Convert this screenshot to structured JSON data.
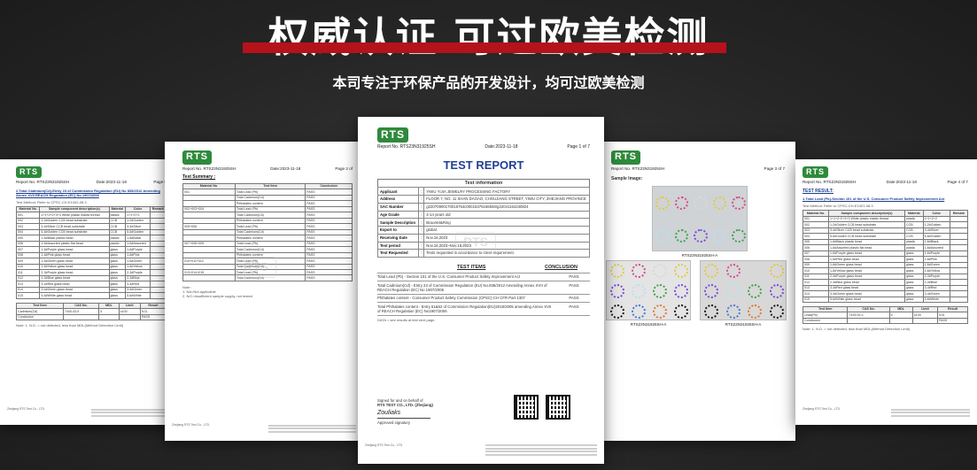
{
  "banner": {
    "headline": "权威认证 可过欧美检测",
    "subhead": "本司专注于环保产品的开发设计，均可过欧美检测",
    "accent_color": "#b5121b"
  },
  "brand": {
    "logo": "RTS",
    "logo_color": "#2f8a3c"
  },
  "doc_center": {
    "report_no": "Report No. RTS23N31925SH",
    "date": "Date:2023-11-18",
    "page": "Page 1 of 7",
    "title": "TEST REPORT",
    "info_heading": "Test information",
    "info": [
      {
        "k": "Applicant",
        "v": "YIWU YIJIA JEWELRY PROCESSING FACTORY"
      },
      {
        "k": "Address",
        "v": "FLOOR 7, NO. 11 SHAN DAOAO, CHOUJIANG STREET, YIWU CITY, ZHEJIANG PROVINCE"
      },
      {
        "k": "SAC Number",
        "v": "g22070900170018754c00015375166550/g22041154230824"
      },
      {
        "k": "Age Grade",
        "v": "4-14 years old"
      },
      {
        "k": "Sample Description",
        "v": "Bracelet&Ring"
      },
      {
        "k": "Export to",
        "v": "global"
      },
      {
        "k": "Receiving Date",
        "v": "Nov.16,2023"
      },
      {
        "k": "Test period",
        "v": "Nov.16,2023~Nov.18,2023"
      },
      {
        "k": "Test Requested",
        "v": "Tests requested in accordance to client requirement."
      }
    ],
    "items_label": "TEST ITEMS",
    "conclusion_label": "CONCLUSION",
    "items": [
      {
        "t": "Total Lead (Pb) - Section 101 of the U.S. Consumer Product Safety Improvement Act",
        "c": "PASS"
      },
      {
        "t": "Total Cadmium(Cd) - Entry 23 of Commission Regulation (EU) No.835/2012 Amending Annex XVII of REACH Regulation (EC) No 1907/2006",
        "c": "PASS"
      },
      {
        "t": "Phthalates content - Consumer Product Safety Commission (CPSC)-CH CFR Part 1307",
        "c": "PASS"
      },
      {
        "t": "Total Phthalates content - Entry 51&52 of Commission Regulation(EU)2018/2005 amending Annex XVII of REACH Regulation (EC) No1907/2006",
        "c": "PASS"
      }
    ],
    "data_note": "DATA = see results at test next page.",
    "signed_for": "Signed for and on behalf of",
    "signed_company": "RTS TEST CO., LTD. (Zhejiang)",
    "approved": "Approved signatory",
    "signature": "Zouliaks",
    "footer_company": "Zhejiang RTS Test Co., LTD."
  },
  "doc_left2": {
    "report_no": "Report No. RTS23N31925SH",
    "date": "Date:2023-11-18",
    "page": "Page 2 of",
    "summary_label": "Test Summary :",
    "headers": [
      "Material No.",
      "Test Item",
      "Conclusion"
    ],
    "rows": [
      {
        "m": "001",
        "t": "Total Lead (Pb)",
        "c": "PASS"
      },
      {
        "m": "",
        "t": "Total Cadmium(Cd)",
        "c": "PASS"
      },
      {
        "m": "",
        "t": "Phthalates content",
        "c": "PASS"
      },
      {
        "m": "002+003+004",
        "t": "Total Lead (Pb)",
        "c": "PASS"
      },
      {
        "m": "",
        "t": "Total Cadmium(Cd)",
        "c": "PASS"
      },
      {
        "m": "",
        "t": "Phthalates content",
        "c": "PASS"
      },
      {
        "m": "005+006",
        "t": "Total Lead (Pb)",
        "c": "PASS"
      },
      {
        "m": "",
        "t": "Total Cadmium(Cd)",
        "c": "PASS"
      },
      {
        "m": "",
        "t": "Phthalates content",
        "c": "PASS"
      },
      {
        "m": "007+008+009",
        "t": "Total Lead (Pb)",
        "c": "PASS"
      },
      {
        "m": "",
        "t": "Total Cadmium(Cd)",
        "c": "PASS"
      },
      {
        "m": "",
        "t": "Phthalates content",
        "c": "PASS"
      },
      {
        "m": "010+011+012",
        "t": "Total Lead (Pb)",
        "c": "PASS"
      },
      {
        "m": "",
        "t": "Total Cadmium(Cd)",
        "c": "PASS"
      },
      {
        "m": "013+014+015",
        "t": "Total Lead (Pb)",
        "c": "PASS"
      },
      {
        "m": "",
        "t": "Total Cadmium(Cd)",
        "c": "PASS"
      }
    ],
    "notes": [
      "Note :",
      "1. NA=Not applicable",
      "2. N/C=Insufficient sample supply, not tested"
    ],
    "footer_company": "Zhejiang RTS Test Co., LTD."
  },
  "doc_left1": {
    "report_no": "Report No. RTS23N31925SH",
    "date": "Date:2023-11-18",
    "page": "Page 5",
    "heading": "2.Total Cadmium(Cd)-Entry 23 of Commission Regulation (EU) No 835/2012 Amending Annex XVII REACH Regulation (EC) No 1907/2006",
    "method": "Test Method: Refer to CPSC-CH-E1002-08.3",
    "headers": [
      "Material No.",
      "Sample component description(s)",
      "Material",
      "Color",
      "Remark"
    ],
    "rows": [
      {
        "n": "001",
        "d": "1+1+2+2+3+3 White plastic elastic thread",
        "m": "plastic",
        "c": "1+1+2+2"
      },
      {
        "n": "002",
        "d": "1-2#Golden CCB bead substrate",
        "m": "CCB",
        "c": "1-2#Golden"
      },
      {
        "n": "003",
        "d": "3-4#Silver CCB bead substrate",
        "m": "CCB",
        "c": "3-4#Silver"
      },
      {
        "n": "004",
        "d": "5-6#Golden CCB bead substrate",
        "m": "CCB",
        "c": "5-6#Golden"
      },
      {
        "n": "005",
        "d": "1-6#Black plastic bead",
        "m": "plastic",
        "c": "1-6#Black"
      },
      {
        "n": "006",
        "d": "1-6#Assorted plastic flat bead",
        "m": "plastic",
        "c": "1-6#Assorted"
      },
      {
        "n": "007",
        "d": "1-6#Purple glass bead",
        "m": "glass",
        "c": "1-6#Purple"
      },
      {
        "n": "008",
        "d": "1-6#Pink glass bead",
        "m": "glass",
        "c": "1-6#Pink"
      },
      {
        "n": "009",
        "d": "1-6#Green glass bead",
        "m": "glass",
        "c": "1-6#Green"
      },
      {
        "n": "010",
        "d": "1-6#Yellow glass bead",
        "m": "glass",
        "c": "1-6#Yellow"
      },
      {
        "n": "011",
        "d": "2-3#Purple glass bead",
        "m": "glass",
        "c": "2-3#Purple"
      },
      {
        "n": "012",
        "d": "2-3#Blue glass bead",
        "m": "glass",
        "c": "2-3#Blue"
      },
      {
        "n": "013",
        "d": "3-4#Red glass bead",
        "m": "glass",
        "c": "3-4#Red"
      },
      {
        "n": "014",
        "d": "3-4#Green glass bead",
        "m": "glass",
        "c": "3-4#Green"
      },
      {
        "n": "015",
        "d": "5-6#White glass bead",
        "m": "glass",
        "c": "5-6#White"
      }
    ],
    "result_headers": [
      "Test Item",
      "CAS No.",
      "MDL",
      "Limit",
      "Result"
    ],
    "result_row": {
      "t": "Cadmium(Cd)",
      "cas": "7440-43-9",
      "mdl": "5",
      "lim": "≤100",
      "res": "N.D."
    },
    "conclusion": "Conclusion",
    "result_pass": "PASS",
    "note": "Note: 1. N.D. = not detected, less than MDL(Method Detection Limit)",
    "footer_company": "Zhejiang RTS Test Co., LTD."
  },
  "doc_right1": {
    "report_no": "Report No. RTS23N31925SH",
    "page": "Page 3 of 7",
    "sample_label": "Sample Image:",
    "caption_a": "RTS23N31925SH-A",
    "caption_b": "RTS23N31925SH-A",
    "caption_c": "RTS23N31925SH-A"
  },
  "doc_right2": {
    "report_no": "Report No. RTS23N31925SH",
    "date": "Date:2023-11-18",
    "page": "Page 4 of 7",
    "heading": "TEST RESULT:",
    "sub": "1.Total Lead (Pb)-Section 101 of the U.S. Consumer Product Safety Improvement Act",
    "method": "Test Method: Refer to CPSC-CH-E1001-08.3",
    "headers": [
      "Material No.",
      "Sample component description(s)",
      "Material",
      "Color",
      "Remark"
    ],
    "rows": [
      {
        "n": "001",
        "d": "1+1+2+2+3+3 White plastic elastic thread",
        "m": "plastic",
        "c": "1+1+2+2"
      },
      {
        "n": "002",
        "d": "1-2#Golden CCB bead substrate",
        "m": "CCB",
        "c": "1-2#Golden"
      },
      {
        "n": "003",
        "d": "3-4#Silver CCB bead substrate",
        "m": "CCB",
        "c": "3-4#Silver"
      },
      {
        "n": "004",
        "d": "5-6#Golden CCB bead substrate",
        "m": "CCB",
        "c": "5-6#Golden"
      },
      {
        "n": "005",
        "d": "1-6#Black plastic bead",
        "m": "plastic",
        "c": "1-6#Black"
      },
      {
        "n": "006",
        "d": "1-6#Assorted plastic flat bead",
        "m": "plastic",
        "c": "1-6#Assorted"
      },
      {
        "n": "007",
        "d": "1-6#Purple glass bead",
        "m": "glass",
        "c": "1-6#Purple"
      },
      {
        "n": "008",
        "d": "1-6#Pink glass bead",
        "m": "glass",
        "c": "1-6#Pink"
      },
      {
        "n": "009",
        "d": "1-6#Green glass bead",
        "m": "glass",
        "c": "1-6#Green"
      },
      {
        "n": "010",
        "d": "1-6#Yellow glass bead",
        "m": "glass",
        "c": "1-6#Yellow"
      },
      {
        "n": "011",
        "d": "2-3#Purple glass bead",
        "m": "glass",
        "c": "2-3#Purple"
      },
      {
        "n": "012",
        "d": "2-3#Blue glass bead",
        "m": "glass",
        "c": "2-3#Blue"
      },
      {
        "n": "013",
        "d": "3-4#Red glass bead",
        "m": "glass",
        "c": "3-4#Red"
      },
      {
        "n": "014",
        "d": "3-4#Green glass bead",
        "m": "glass",
        "c": "3-4#Green"
      },
      {
        "n": "015",
        "d": "5-6#White glass bead",
        "m": "glass",
        "c": "5-6#White"
      }
    ],
    "result_headers": [
      "Test Item",
      "CAS No.",
      "MDL",
      "Limit",
      "Result"
    ],
    "result_row": {
      "t": "Lead(Pb)",
      "cas": "7439-92-1",
      "mdl": "5",
      "lim": "≤100",
      "res": "N.D."
    },
    "conclusion": "Conclusion",
    "result_pass": "PASS",
    "note": "Note: 1. N.D. = not detected, less than MDL(Method Detection Limit)",
    "footer_company": "Zhejiang RTS Test Co., LTD."
  }
}
